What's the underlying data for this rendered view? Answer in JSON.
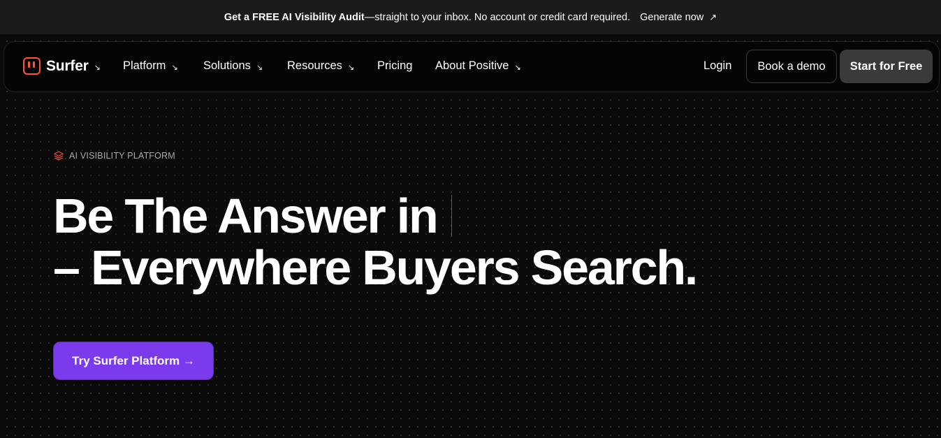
{
  "announcement": {
    "bold": "Get a FREE AI Visibility Audit",
    "rest": "—straight to your inbox. No account or credit card required.",
    "link": "Generate now",
    "link_icon": "↗"
  },
  "nav": {
    "logo": "Surfer",
    "items": [
      {
        "label": "Platform",
        "dropdown": true
      },
      {
        "label": "Solutions",
        "dropdown": true
      },
      {
        "label": "Resources",
        "dropdown": true
      },
      {
        "label": "Pricing",
        "dropdown": false
      },
      {
        "label": "About Positive",
        "dropdown": true
      }
    ],
    "chevron": "↘",
    "login": "Login",
    "demo": "Book a demo",
    "start": "Start for Free"
  },
  "hero": {
    "eyebrow": "AI VISIBILITY PLATFORM",
    "headline_line1": "Be The Answer in",
    "headline_line2": "– Everywhere Buyers Search.",
    "cta": "Try Surfer Platform →"
  },
  "colors": {
    "accent": "#7c3aed",
    "logo": "#ff5533",
    "background": "#0a0a0a"
  }
}
